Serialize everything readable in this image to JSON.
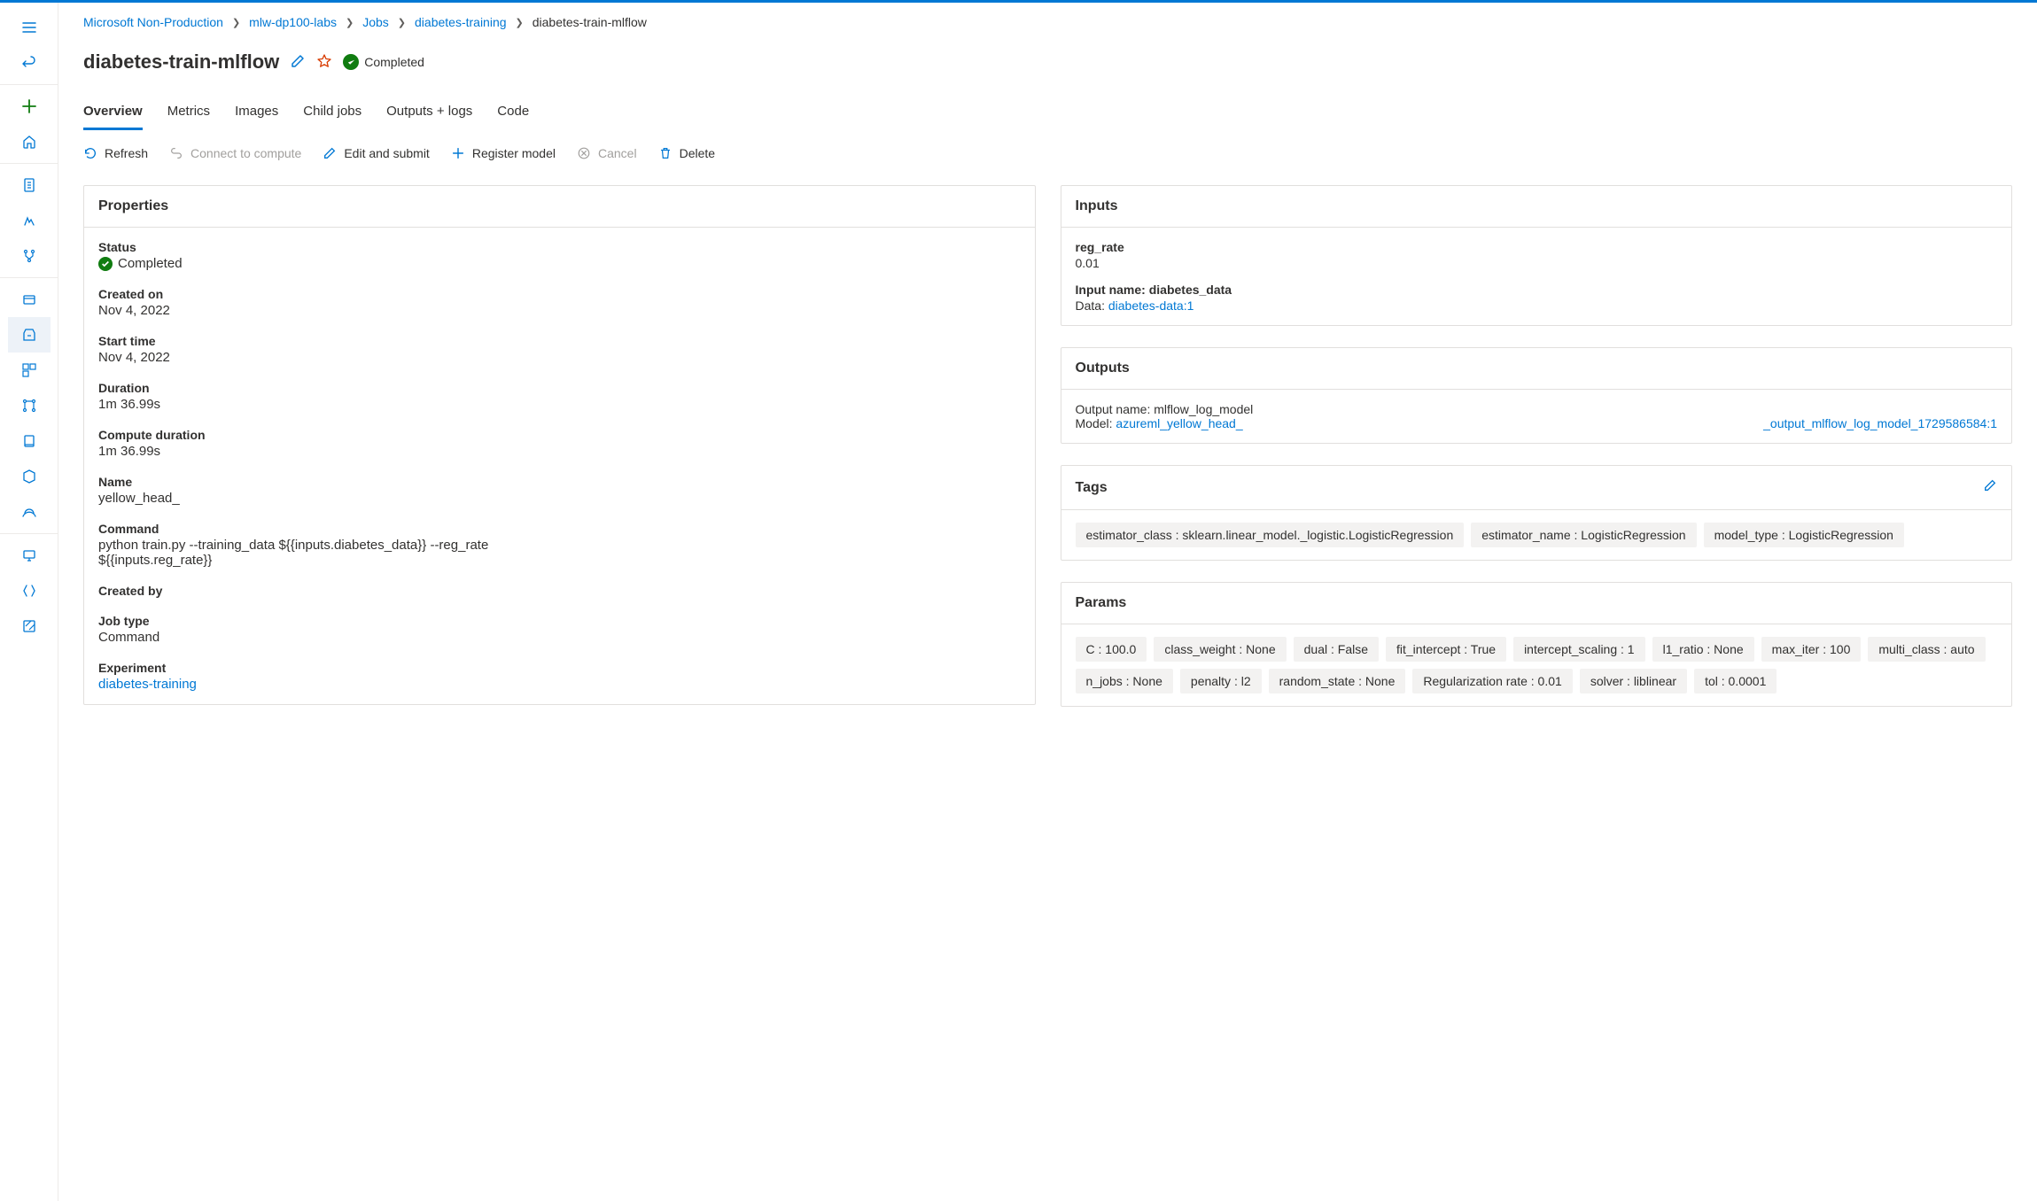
{
  "breadcrumb": {
    "items": [
      "Microsoft Non-Production",
      "mlw-dp100-labs",
      "Jobs",
      "diabetes-training"
    ],
    "current": "diabetes-train-mlflow"
  },
  "title": "diabetes-train-mlflow",
  "status_label": "Completed",
  "tabs": [
    "Overview",
    "Metrics",
    "Images",
    "Child jobs",
    "Outputs + logs",
    "Code"
  ],
  "toolbar": {
    "refresh": "Refresh",
    "connect": "Connect to compute",
    "edit": "Edit and submit",
    "register": "Register model",
    "cancel": "Cancel",
    "delete": "Delete"
  },
  "panels": {
    "properties_title": "Properties",
    "inputs_title": "Inputs",
    "outputs_title": "Outputs",
    "tags_title": "Tags",
    "params_title": "Params"
  },
  "properties": {
    "status": {
      "k": "Status",
      "v": "Completed"
    },
    "created": {
      "k": "Created on",
      "v": "Nov 4, 2022"
    },
    "start": {
      "k": "Start time",
      "v": "Nov 4, 2022"
    },
    "duration": {
      "k": "Duration",
      "v": "1m 36.99s"
    },
    "compute_duration": {
      "k": "Compute duration",
      "v": "1m 36.99s"
    },
    "name": {
      "k": "Name",
      "v": "yellow_head_"
    },
    "command": {
      "k": "Command",
      "v": "python train.py --training_data ${{inputs.diabetes_data}} --reg_rate ${{inputs.reg_rate}}"
    },
    "created_by": {
      "k": "Created by",
      "v": ""
    },
    "job_type": {
      "k": "Job type",
      "v": "Command"
    },
    "experiment": {
      "k": "Experiment",
      "v": "diabetes-training"
    }
  },
  "inputs": {
    "reg_rate": {
      "k": "reg_rate",
      "v": "0.01"
    },
    "data": {
      "k": "Input name: diabetes_data",
      "label": "Data: ",
      "link": "diabetes-data:1"
    }
  },
  "outputs": {
    "name_label": "Output name: mlflow_log_model",
    "model_label": "Model: ",
    "model_link_a": "azureml_yellow_head_",
    "model_link_b": "_output_mlflow_log_model_1729586584:1"
  },
  "tags": [
    "estimator_class : sklearn.linear_model._logistic.LogisticRegression",
    "estimator_name : LogisticRegression",
    "model_type : LogisticRegression"
  ],
  "params": [
    "C : 100.0",
    "class_weight : None",
    "dual : False",
    "fit_intercept : True",
    "intercept_scaling : 1",
    "l1_ratio : None",
    "max_iter : 100",
    "multi_class : auto",
    "n_jobs : None",
    "penalty : l2",
    "random_state : None",
    "Regularization rate : 0.01",
    "solver : liblinear",
    "tol : 0.0001"
  ]
}
